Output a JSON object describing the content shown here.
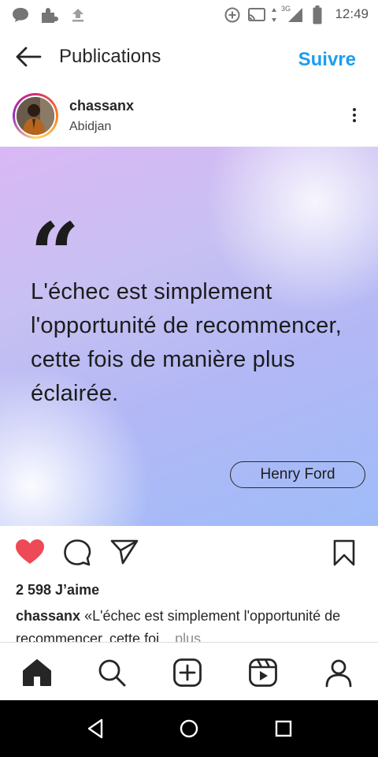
{
  "status_bar": {
    "time": "12:49",
    "network_label": "3G",
    "icons": [
      "chat-notification-icon",
      "puzzle-notification-icon",
      "upload-icon",
      "add-circle-icon",
      "cast-icon",
      "data-arrows-icon",
      "signal-icon",
      "battery-icon"
    ]
  },
  "header": {
    "title": "Publications",
    "follow_label": "Suivre",
    "accent_color": "#1a9ef0"
  },
  "post": {
    "username": "chassanx",
    "location": "Abidjan",
    "quote": {
      "mark": "“",
      "text": "L'échec est simplement l'opportunité de recommencer, cette fois de manière plus éclairée.",
      "author": "Henry Ford"
    },
    "liked": true,
    "like_color": "#ed4956",
    "likes": "2 598 J’aime",
    "caption_user": "chassanx",
    "caption_text": " «L'échec est simplement l'opportunité de recommencer, cette foi",
    "caption_more": "... plus"
  },
  "bottom_nav": {
    "items": [
      "home-icon",
      "search-icon",
      "add-post-icon",
      "reels-icon",
      "profile-icon"
    ]
  },
  "android_nav": {
    "items": [
      "back-triangle-icon",
      "home-circle-icon",
      "recents-square-icon"
    ]
  }
}
